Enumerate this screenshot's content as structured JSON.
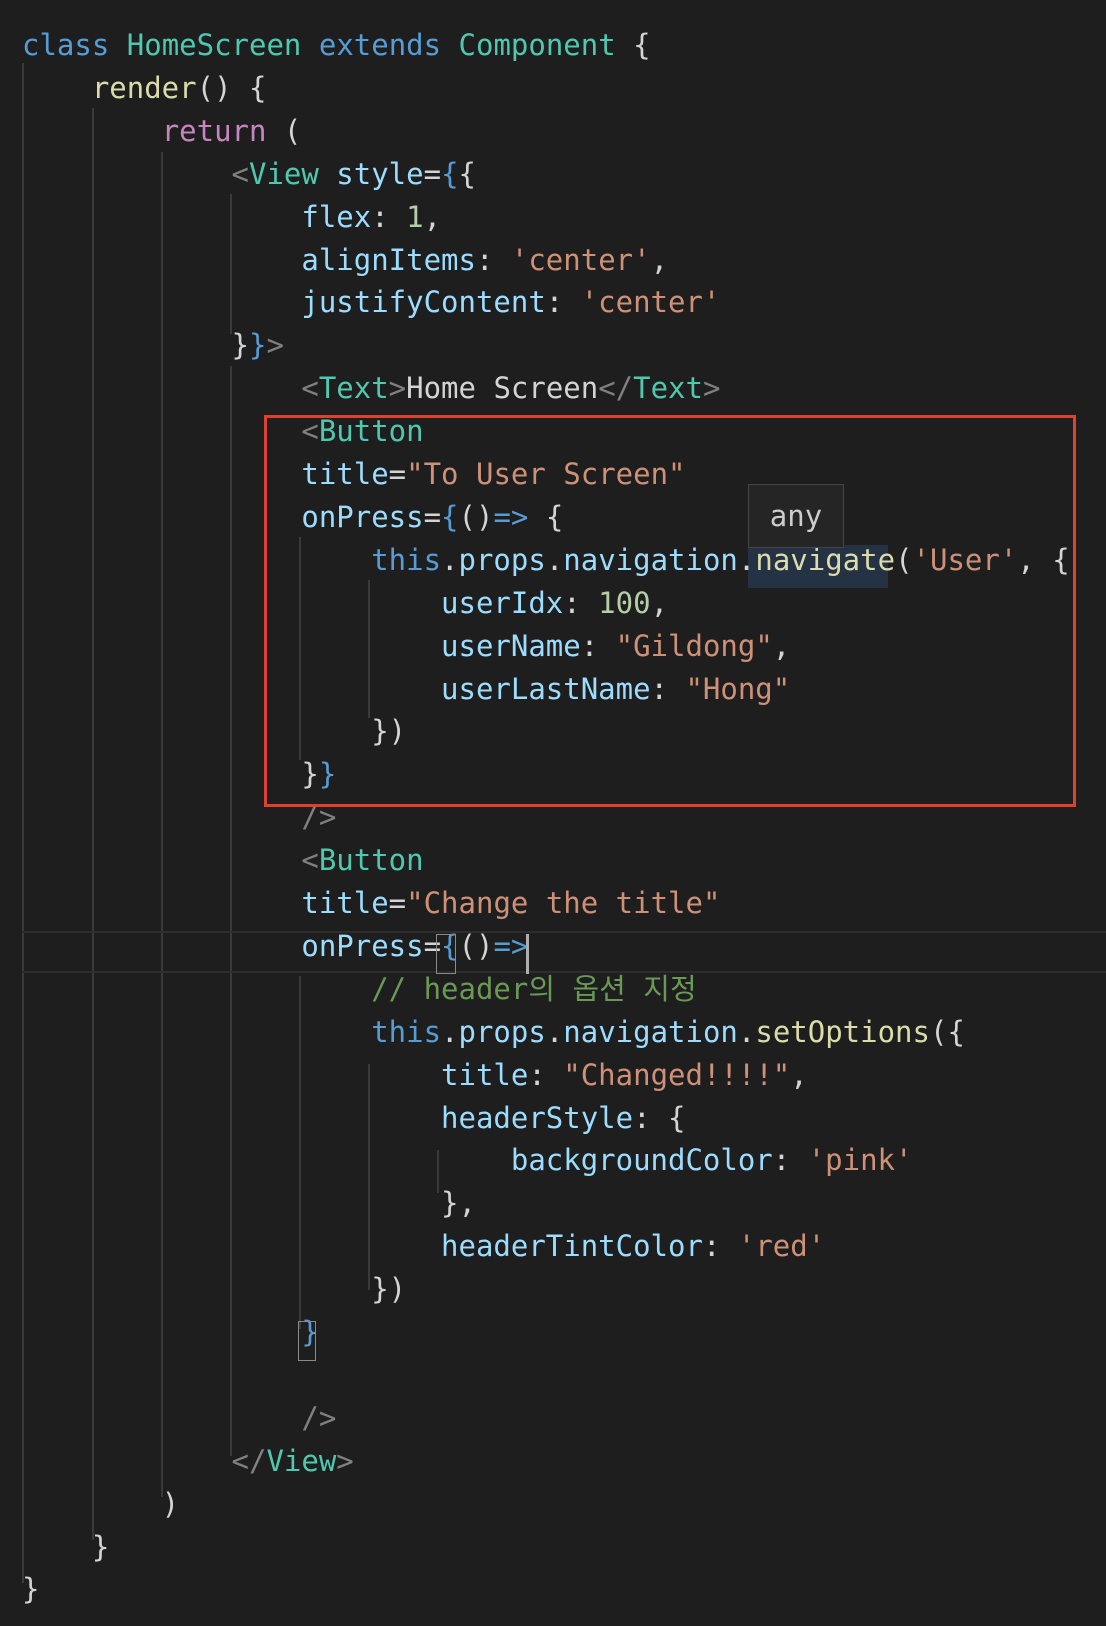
{
  "editor": {
    "colors": {
      "background": "#1e1e1e",
      "keyword_blue": "#569cd6",
      "keyword_purple": "#c586c0",
      "type_teal": "#4ec9b0",
      "function_yellow": "#dcdcaa",
      "property_blue": "#9cdcfe",
      "string_orange": "#ce9178",
      "number_green": "#b5cea8",
      "comment_green": "#6a9955",
      "tag_gray": "#808080",
      "highlight_border": "#e0412e"
    },
    "tooltip_text": "any",
    "lines": [
      [
        {
          "t": "class",
          "c": "#569cd6"
        },
        {
          "t": " "
        },
        {
          "t": "HomeScreen",
          "c": "#4ec9b0"
        },
        {
          "t": " "
        },
        {
          "t": "extends",
          "c": "#569cd6"
        },
        {
          "t": " "
        },
        {
          "t": "Component",
          "c": "#4ec9b0"
        },
        {
          "t": " {"
        }
      ],
      [
        {
          "t": "    "
        },
        {
          "t": "render",
          "c": "#dcdcaa"
        },
        {
          "t": "() {"
        }
      ],
      [
        {
          "t": "        "
        },
        {
          "t": "return",
          "c": "#c586c0"
        },
        {
          "t": " ("
        }
      ],
      [
        {
          "t": "            "
        },
        {
          "t": "<",
          "c": "#808080"
        },
        {
          "t": "View",
          "c": "#4ec9b0"
        },
        {
          "t": " "
        },
        {
          "t": "style",
          "c": "#9cdcfe"
        },
        {
          "t": "="
        },
        {
          "t": "{",
          "c": "#569cd6"
        },
        {
          "t": "{"
        }
      ],
      [
        {
          "t": "                "
        },
        {
          "t": "flex",
          "c": "#9cdcfe"
        },
        {
          "t": ": "
        },
        {
          "t": "1",
          "c": "#b5cea8"
        },
        {
          "t": ","
        }
      ],
      [
        {
          "t": "                "
        },
        {
          "t": "alignItems",
          "c": "#9cdcfe"
        },
        {
          "t": ": "
        },
        {
          "t": "'center'",
          "c": "#ce9178"
        },
        {
          "t": ","
        }
      ],
      [
        {
          "t": "                "
        },
        {
          "t": "justifyContent",
          "c": "#9cdcfe"
        },
        {
          "t": ": "
        },
        {
          "t": "'center'",
          "c": "#ce9178"
        }
      ],
      [
        {
          "t": "            }"
        },
        {
          "t": "}",
          "c": "#569cd6"
        },
        {
          "t": ">",
          "c": "#808080"
        }
      ],
      [
        {
          "t": "                "
        },
        {
          "t": "<",
          "c": "#808080"
        },
        {
          "t": "Text",
          "c": "#4ec9b0"
        },
        {
          "t": ">",
          "c": "#808080"
        },
        {
          "t": "Home Screen"
        },
        {
          "t": "</",
          "c": "#808080"
        },
        {
          "t": "Text",
          "c": "#4ec9b0"
        },
        {
          "t": ">",
          "c": "#808080"
        }
      ],
      [
        {
          "t": "                "
        },
        {
          "t": "<",
          "c": "#808080"
        },
        {
          "t": "Button",
          "c": "#4ec9b0"
        }
      ],
      [
        {
          "t": "                "
        },
        {
          "t": "title",
          "c": "#9cdcfe"
        },
        {
          "t": "="
        },
        {
          "t": "\"To User Screen\"",
          "c": "#ce9178"
        }
      ],
      [
        {
          "t": "                "
        },
        {
          "t": "onPress",
          "c": "#9cdcfe"
        },
        {
          "t": "="
        },
        {
          "t": "{",
          "c": "#569cd6"
        },
        {
          "t": "()"
        },
        {
          "t": "=>",
          "c": "#569cd6"
        },
        {
          "t": " {"
        }
      ],
      [
        {
          "t": "                    "
        },
        {
          "t": "this",
          "c": "#569cd6"
        },
        {
          "t": "."
        },
        {
          "t": "props",
          "c": "#9cdcfe"
        },
        {
          "t": "."
        },
        {
          "t": "navigation",
          "c": "#9cdcfe"
        },
        {
          "t": "."
        },
        {
          "t": "navigate",
          "c": "#dcdcaa"
        },
        {
          "t": "("
        },
        {
          "t": "'User'",
          "c": "#ce9178"
        },
        {
          "t": ", {"
        }
      ],
      [
        {
          "t": "                        "
        },
        {
          "t": "userIdx",
          "c": "#9cdcfe"
        },
        {
          "t": ": "
        },
        {
          "t": "100",
          "c": "#b5cea8"
        },
        {
          "t": ","
        }
      ],
      [
        {
          "t": "                        "
        },
        {
          "t": "userName",
          "c": "#9cdcfe"
        },
        {
          "t": ": "
        },
        {
          "t": "\"Gildong\"",
          "c": "#ce9178"
        },
        {
          "t": ","
        }
      ],
      [
        {
          "t": "                        "
        },
        {
          "t": "userLastName",
          "c": "#9cdcfe"
        },
        {
          "t": ": "
        },
        {
          "t": "\"Hong\"",
          "c": "#ce9178"
        }
      ],
      [
        {
          "t": "                    })"
        }
      ],
      [
        {
          "t": "                }"
        },
        {
          "t": "}",
          "c": "#569cd6"
        }
      ],
      [
        {
          "t": "                "
        },
        {
          "t": "/>",
          "c": "#808080"
        }
      ],
      [
        {
          "t": "                "
        },
        {
          "t": "<",
          "c": "#808080"
        },
        {
          "t": "Button",
          "c": "#4ec9b0"
        }
      ],
      [
        {
          "t": "                "
        },
        {
          "t": "title",
          "c": "#9cdcfe"
        },
        {
          "t": "="
        },
        {
          "t": "\"Change the title\"",
          "c": "#ce9178"
        }
      ],
      [
        {
          "t": "                "
        },
        {
          "t": "onPress",
          "c": "#9cdcfe"
        },
        {
          "t": "="
        },
        {
          "t": "{",
          "c": "#569cd6"
        },
        {
          "t": "()"
        },
        {
          "t": "=>",
          "c": "#569cd6"
        }
      ],
      [
        {
          "t": "                    "
        },
        {
          "t": "// header의 옵션 지정",
          "c": "#6a9955"
        }
      ],
      [
        {
          "t": "                    "
        },
        {
          "t": "this",
          "c": "#569cd6"
        },
        {
          "t": "."
        },
        {
          "t": "props",
          "c": "#9cdcfe"
        },
        {
          "t": "."
        },
        {
          "t": "navigation",
          "c": "#9cdcfe"
        },
        {
          "t": "."
        },
        {
          "t": "setOptions",
          "c": "#dcdcaa"
        },
        {
          "t": "({"
        }
      ],
      [
        {
          "t": "                        "
        },
        {
          "t": "title",
          "c": "#9cdcfe"
        },
        {
          "t": ": "
        },
        {
          "t": "\"Changed!!!!\"",
          "c": "#ce9178"
        },
        {
          "t": ","
        }
      ],
      [
        {
          "t": "                        "
        },
        {
          "t": "headerStyle",
          "c": "#9cdcfe"
        },
        {
          "t": ": {"
        }
      ],
      [
        {
          "t": "                            "
        },
        {
          "t": "backgroundColor",
          "c": "#9cdcfe"
        },
        {
          "t": ": "
        },
        {
          "t": "'pink'",
          "c": "#ce9178"
        }
      ],
      [
        {
          "t": "                        },"
        }
      ],
      [
        {
          "t": "                        "
        },
        {
          "t": "headerTintColor",
          "c": "#9cdcfe"
        },
        {
          "t": ": "
        },
        {
          "t": "'red'",
          "c": "#ce9178"
        }
      ],
      [
        {
          "t": "                    })"
        }
      ],
      [
        {
          "t": "                "
        },
        {
          "t": "}",
          "c": "#569cd6"
        }
      ],
      [
        {
          "t": ""
        }
      ],
      [
        {
          "t": "                "
        },
        {
          "t": "/>",
          "c": "#808080"
        }
      ],
      [
        {
          "t": "            "
        },
        {
          "t": "</",
          "c": "#808080"
        },
        {
          "t": "View",
          "c": "#4ec9b0"
        },
        {
          "t": ">",
          "c": "#808080"
        }
      ],
      [
        {
          "t": "        )"
        }
      ],
      [
        {
          "t": "    }"
        }
      ],
      [
        {
          "t": "}"
        }
      ]
    ]
  }
}
